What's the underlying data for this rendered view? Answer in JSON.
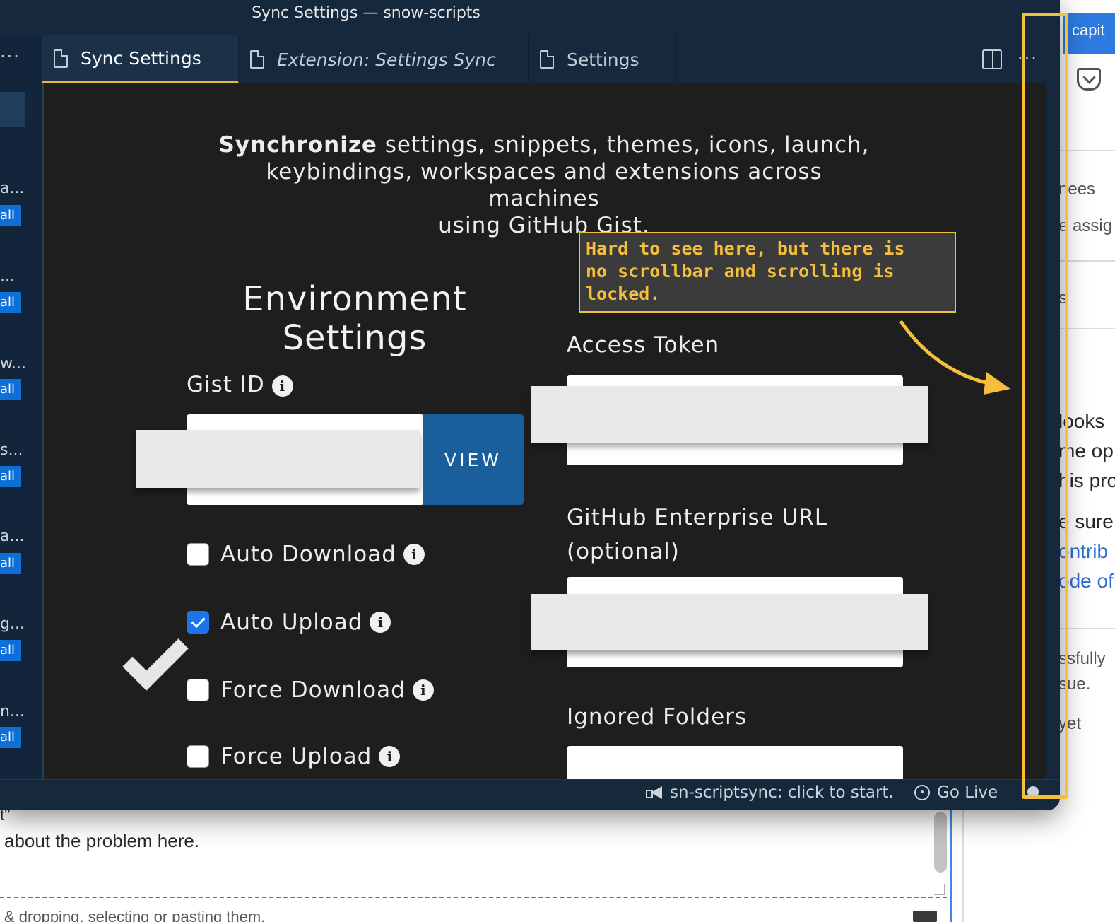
{
  "window": {
    "title": "Sync Settings — snow-scripts"
  },
  "sidebar": {
    "more_glyph": "···",
    "items": [
      {
        "text": "a...",
        "button": "all"
      },
      {
        "text": "...",
        "button": "all"
      },
      {
        "text": "w...",
        "button": "all"
      },
      {
        "text": "s...",
        "button": "all"
      },
      {
        "text": "a...",
        "button": "all"
      },
      {
        "text": "g...",
        "button": "all"
      },
      {
        "text": "n...",
        "button": "all"
      }
    ]
  },
  "tabs": [
    {
      "label": "Sync Settings",
      "active": true
    },
    {
      "label": "Extension: Settings Sync",
      "active": false,
      "italic": true
    },
    {
      "label": "Settings",
      "active": false
    }
  ],
  "tab_actions": {
    "more_glyph": "···"
  },
  "editor": {
    "intro_bold": "Synchronize",
    "intro_line1_rest": " settings, snippets, themes, icons, launch,",
    "intro_line2": "keybindings, workspaces and extensions across machines",
    "intro_line3": "using GitHub Gist.",
    "env_title_line1": "Environment",
    "env_title_line2": "Settings",
    "gist_id_label": "Gist ID",
    "view_button": "VIEW",
    "checkboxes": [
      {
        "label": "Auto Download",
        "checked": false
      },
      {
        "label": "Auto Upload",
        "checked": true
      },
      {
        "label": "Force Download",
        "checked": false
      },
      {
        "label": "Force Upload",
        "checked": false
      }
    ],
    "access_token_label": "Access Token",
    "enterprise_url_label_line1": "GitHub Enterprise URL",
    "enterprise_url_label_line2": "(optional)",
    "ignored_folders_label": "Ignored Folders",
    "info_glyph": "i"
  },
  "statusbar": {
    "sync_text": "sn-scriptsync: click to start.",
    "go_live": "Go Live"
  },
  "annotation": {
    "line1": "Hard to see here, but there is",
    "line2": "no scrollbar and scrolling is",
    "line3": "locked.",
    "color": "#f5be3c"
  },
  "background_page": {
    "text_partial": "t''",
    "text_line": "about the problem here.",
    "bottom_text": "& dropping, selecting or pasting them.",
    "right_tab": "capit",
    "right_texts": [
      "nees",
      "e assig",
      "s",
      "looks",
      "me op",
      "his pro",
      "e sure",
      "ontrib",
      "ode of",
      "ssfully",
      "sue.",
      "yet"
    ]
  },
  "colors": {
    "window_bg": "#16283b",
    "editor_bg": "#1e1e1e",
    "accent_blue": "#1a5f9c",
    "checkbox_checked": "#1c74e8",
    "active_tab_border": "#e8b93a"
  },
  "icons": [
    "file-icon",
    "split-editor-icon",
    "more-icon",
    "info-icon",
    "checkmark-icon",
    "megaphone-icon",
    "broadcast-icon",
    "bell-icon",
    "pocket-icon",
    "arrow-icon"
  ]
}
